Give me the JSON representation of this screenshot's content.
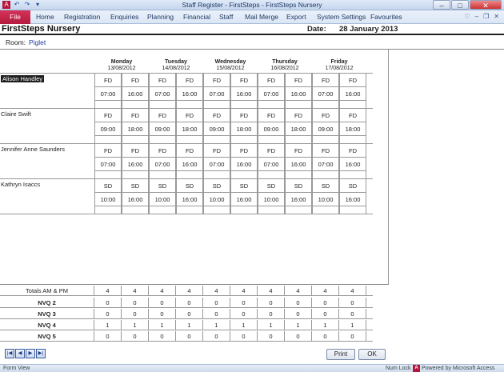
{
  "window": {
    "title": "Staff Register - FirstSteps - FirstSteps Nursery",
    "min_glyph": "–",
    "max_glyph": "□",
    "close_glyph": "✕",
    "qat_icons": [
      "access-icon",
      "undo-icon",
      "redo-icon",
      "customize-icon"
    ]
  },
  "menu": {
    "file": "File",
    "items": [
      "Home",
      "Registration",
      "Enquiries",
      "Planning",
      "Financial",
      "Staff",
      "Mail Merge",
      "Export",
      "System Settings",
      "Favourites"
    ],
    "right_glyphs": [
      "♡",
      "–",
      "❐",
      "✕"
    ]
  },
  "header": {
    "title": "FirstSteps Nursery",
    "date_label": "Date:",
    "date_value": "28 January 2013"
  },
  "room": {
    "label": "Room:",
    "value": "Piglet"
  },
  "days": [
    {
      "name": "Monday",
      "date": "13/08/2012"
    },
    {
      "name": "Tuesday",
      "date": "14/08/2012"
    },
    {
      "name": "Wednesday",
      "date": "15/08/2012"
    },
    {
      "name": "Thursday",
      "date": "16/08/2012"
    },
    {
      "name": "Friday",
      "date": "17/08/2012"
    }
  ],
  "staff": [
    {
      "name": "Alison Handley",
      "codes": [
        "FD",
        "FD",
        "FD",
        "FD",
        "FD",
        "FD",
        "FD",
        "FD",
        "FD",
        "FD"
      ],
      "times": [
        "07:00",
        "16:00",
        "07:00",
        "16:00",
        "07:00",
        "16:00",
        "07:00",
        "16:00",
        "07:00",
        "16:00"
      ]
    },
    {
      "name": "Claire Swift",
      "codes": [
        "FD",
        "FD",
        "FD",
        "FD",
        "FD",
        "FD",
        "FD",
        "FD",
        "FD",
        "FD"
      ],
      "times": [
        "09:00",
        "18:00",
        "09:00",
        "18:00",
        "09:00",
        "18:00",
        "09:00",
        "18:00",
        "09:00",
        "18:00"
      ]
    },
    {
      "name": "Jennifer Anne Saunders",
      "codes": [
        "FD",
        "FD",
        "FD",
        "FD",
        "FD",
        "FD",
        "FD",
        "FD",
        "FD",
        "FD"
      ],
      "times": [
        "07:00",
        "16:00",
        "07:00",
        "16:00",
        "07:00",
        "16:00",
        "07:00",
        "16:00",
        "07:00",
        "16:00"
      ]
    },
    {
      "name": "Kathryn Isaccs",
      "codes": [
        "SD",
        "SD",
        "SD",
        "SD",
        "SD",
        "SD",
        "SD",
        "SD",
        "SD",
        "SD"
      ],
      "times": [
        "10:00",
        "16:00",
        "10:00",
        "16:00",
        "10:00",
        "16:00",
        "10:00",
        "16:00",
        "10:00",
        "16:00"
      ]
    }
  ],
  "totals": [
    {
      "label": "Totals AM & PM",
      "values": [
        "4",
        "4",
        "4",
        "4",
        "4",
        "4",
        "4",
        "4",
        "4",
        "4"
      ]
    },
    {
      "label": "NVQ 2",
      "values": [
        "0",
        "0",
        "0",
        "0",
        "0",
        "0",
        "0",
        "0",
        "0",
        "0"
      ]
    },
    {
      "label": "NVQ 3",
      "values": [
        "0",
        "0",
        "0",
        "0",
        "0",
        "0",
        "0",
        "0",
        "0",
        "0"
      ]
    },
    {
      "label": "NVQ 4",
      "values": [
        "1",
        "1",
        "1",
        "1",
        "1",
        "1",
        "1",
        "1",
        "1",
        "1"
      ]
    },
    {
      "label": "NVQ 5",
      "values": [
        "0",
        "0",
        "0",
        "0",
        "0",
        "0",
        "0",
        "0",
        "0",
        "0"
      ]
    }
  ],
  "nav": {
    "first": "|◀",
    "prev": "◀",
    "next": "▶",
    "last": "▶|"
  },
  "buttons": {
    "print": "Print",
    "ok": "OK"
  },
  "status": {
    "view": "Form View",
    "num_lock": "Num Lock",
    "access_logo": "A",
    "powered": "Powered by Microsoft Access"
  }
}
